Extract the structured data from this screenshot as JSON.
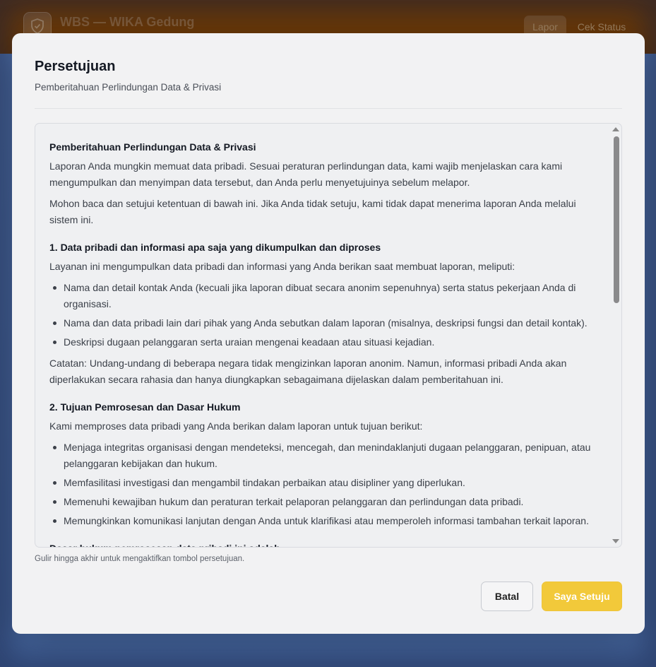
{
  "background": {
    "app_title": "WBS — WIKA Gedung",
    "logo_icon": "shield-check-icon",
    "nav": [
      {
        "label": "Lapor",
        "active": true
      },
      {
        "label": "Cek Status",
        "active": false
      }
    ]
  },
  "modal": {
    "title": "Persetujuan",
    "subtitle": "Pemberitahuan Perlindungan Data & Privasi",
    "content": {
      "heading": "Pemberitahuan Perlindungan Data & Privasi",
      "intro_paragraphs": [
        "Laporan Anda mungkin memuat data pribadi. Sesuai peraturan perlindungan data, kami wajib menjelaskan cara kami mengumpulkan dan menyimpan data tersebut, dan Anda perlu menyetujuinya sebelum melapor.",
        "Mohon baca dan setujui ketentuan di bawah ini. Jika Anda tidak setuju, kami tidak dapat menerima laporan Anda melalui sistem ini."
      ],
      "section1": {
        "heading": "1. Data pribadi dan informasi apa saja yang dikumpulkan dan diproses",
        "lead": "Layanan ini mengumpulkan data pribadi dan informasi yang Anda berikan saat membuat laporan, meliputi:",
        "items": [
          "Nama dan detail kontak Anda (kecuali jika laporan dibuat secara anonim sepenuhnya) serta status pekerjaan Anda di organisasi.",
          "Nama dan data pribadi lain dari pihak yang Anda sebutkan dalam laporan (misalnya, deskripsi fungsi dan detail kontak).",
          "Deskripsi dugaan pelanggaran serta uraian mengenai keadaan atau situasi kejadian."
        ],
        "note": "Catatan: Undang-undang di beberapa negara tidak mengizinkan laporan anonim. Namun, informasi pribadi Anda akan diperlakukan secara rahasia dan hanya diungkapkan sebagaimana dijelaskan dalam pemberitahuan ini."
      },
      "section2": {
        "heading": "2. Tujuan Pemrosesan dan Dasar Hukum",
        "lead": "Kami memproses data pribadi yang Anda berikan dalam laporan untuk tujuan berikut:",
        "items": [
          "Menjaga integritas organisasi dengan mendeteksi, mencegah, dan menindaklanjuti dugaan pelanggaran, penipuan, atau pelanggaran kebijakan dan hukum.",
          "Memfasilitasi investigasi dan mengambil tindakan perbaikan atau disipliner yang diperlukan.",
          "Memenuhi kewajiban hukum dan peraturan terkait pelaporan pelanggaran dan perlindungan data pribadi.",
          "Memungkinkan komunikasi lanjutan dengan Anda untuk klarifikasi atau memperoleh informasi tambahan terkait laporan."
        ],
        "legal_basis_heading": "Dasar hukum pemrosesan data pribadi ini adalah:"
      }
    },
    "scroll_hint": "Gulir hingga akhir untuk mengaktifkan tombol persetujuan.",
    "cancel_label": "Batal",
    "agree_label": "Saya Setuju",
    "accent_color": "#f2c93a"
  }
}
